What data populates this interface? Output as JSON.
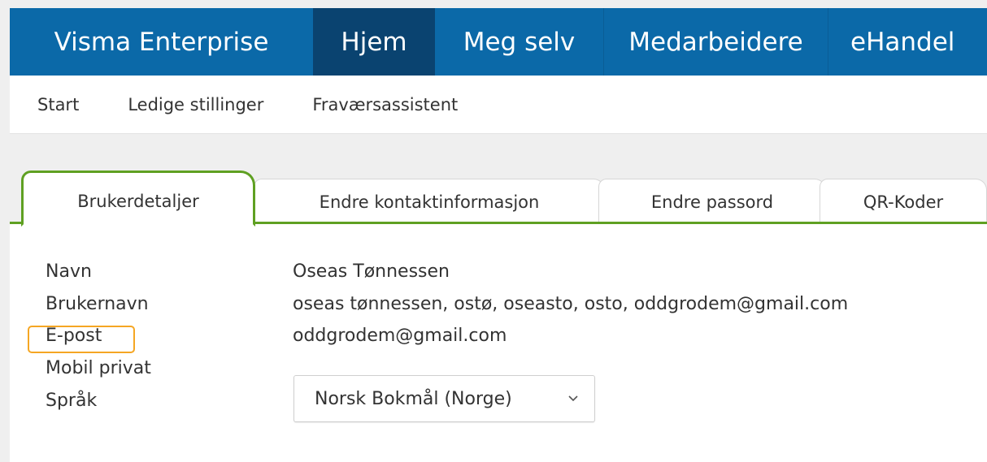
{
  "topnav": {
    "brand": "Visma Enterprise",
    "items": [
      "Hjem",
      "Meg selv",
      "Medarbeidere",
      "eHandel"
    ],
    "active": "Hjem"
  },
  "subnav": {
    "items": [
      "Start",
      "Ledige stillinger",
      "Fraværsassistent"
    ]
  },
  "tabs": [
    {
      "label": "Brukerdetaljer",
      "active": true
    },
    {
      "label": "Endre kontaktinformasjon",
      "active": false
    },
    {
      "label": "Endre passord",
      "active": false
    },
    {
      "label": "QR-Koder",
      "active": false
    }
  ],
  "details": {
    "labels": [
      "Navn",
      "Brukernavn",
      "E-post",
      "Mobil privat",
      "Språk"
    ],
    "name": "Oseas Tønnessen",
    "username": "oseas tønnessen, ostø, oseasto, osto, oddgrodem@gmail.com",
    "email": "oddgrodem@gmail.com",
    "mobile": "",
    "language": "Norsk Bokmål (Norge)"
  },
  "colors": {
    "topbar": "#0b69a8",
    "topbar_active": "#0a4370",
    "tab_accent": "#5fa022",
    "highlight": "#f5a623"
  }
}
